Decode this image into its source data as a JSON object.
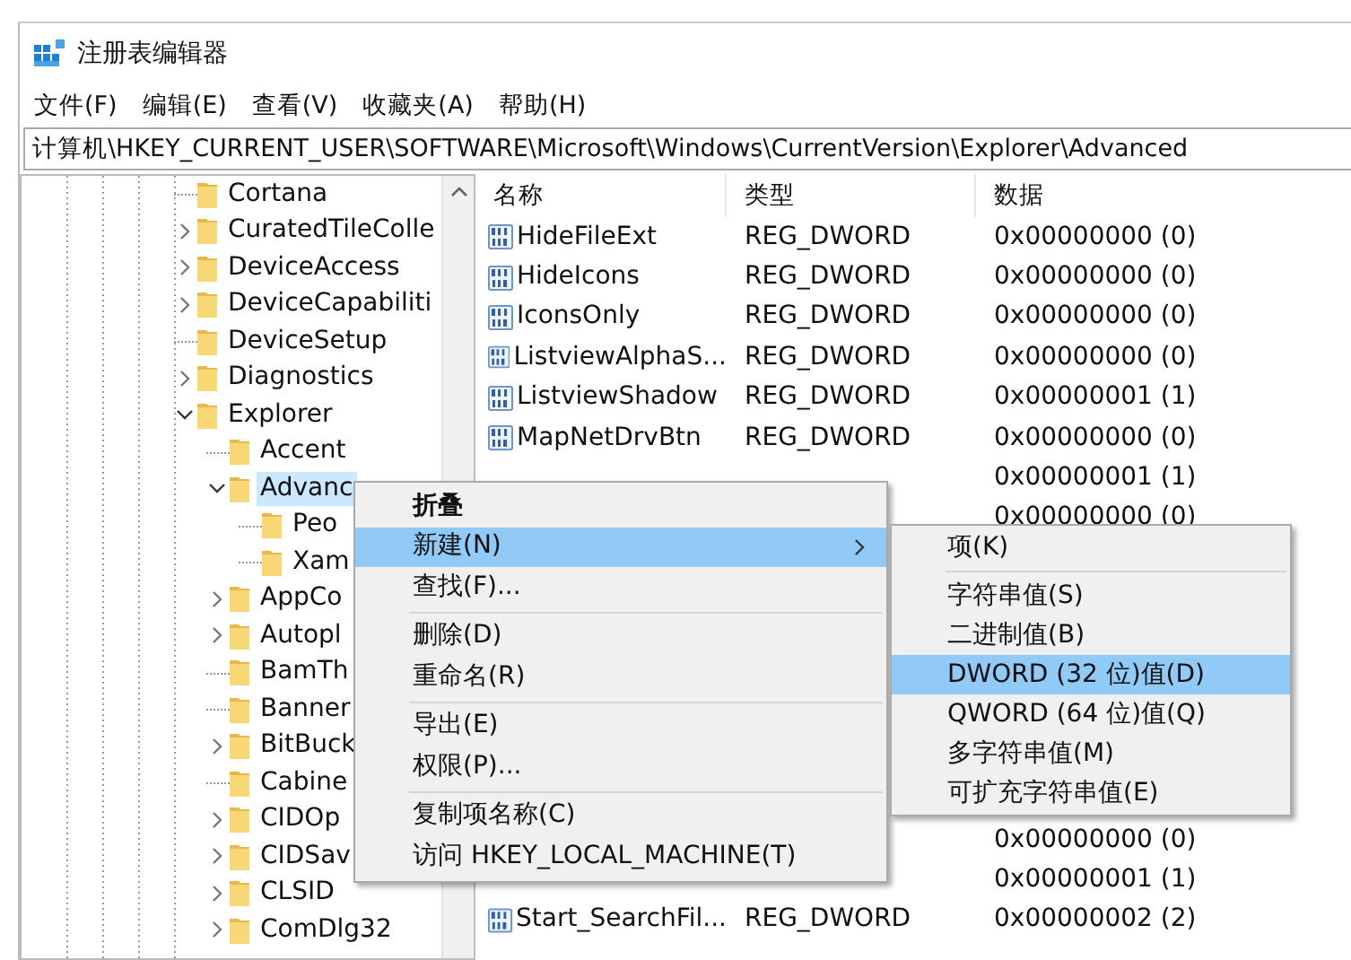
{
  "window": {
    "title": "注册表编辑器"
  },
  "menu_bar": [
    "文件(F)",
    "编辑(E)",
    "查看(V)",
    "收藏夹(A)",
    "帮助(H)"
  ],
  "address": "计算机\\HKEY_CURRENT_USER\\SOFTWARE\\Microsoft\\Windows\\CurrentVersion\\Explorer\\Advanced",
  "tree": {
    "items": [
      {
        "label": "Cortana",
        "selected": false
      },
      {
        "label": "CuratedTileColle",
        "expanded": false,
        "selected": false
      },
      {
        "label": "DeviceAccess",
        "expanded": false,
        "selected": false
      },
      {
        "label": "DeviceCapabiliti",
        "expanded": false,
        "selected": false
      },
      {
        "label": "DeviceSetup",
        "selected": false
      },
      {
        "label": "Diagnostics",
        "expanded": false,
        "selected": false
      },
      {
        "label": "Explorer",
        "expanded": true,
        "selected": false,
        "children": [
          {
            "label": "Accent",
            "selected": false
          },
          {
            "label": "Advanc",
            "expanded": true,
            "selected": true,
            "children": [
              {
                "label": "Peo",
                "selected": false
              },
              {
                "label": "Xam",
                "selected": false
              }
            ]
          },
          {
            "label": "AppCo",
            "expanded": false,
            "selected": false
          },
          {
            "label": "Autopl",
            "expanded": false,
            "selected": false
          },
          {
            "label": "BamTh",
            "selected": false
          },
          {
            "label": "Banner",
            "selected": false
          },
          {
            "label": "BitBuck",
            "expanded": false,
            "selected": false
          },
          {
            "label": "Cabine",
            "selected": false
          },
          {
            "label": "CIDOp",
            "expanded": false,
            "selected": false
          },
          {
            "label": "CIDSav",
            "expanded": false,
            "selected": false
          },
          {
            "label": "CLSID",
            "expanded": false,
            "selected": false
          },
          {
            "label": "ComDlg32",
            "expanded": false,
            "selected": false
          }
        ]
      }
    ]
  },
  "table": {
    "columns": [
      "名称",
      "类型",
      "数据"
    ],
    "rows_top": [
      {
        "name": "HideFileExt",
        "type": "REG_DWORD",
        "data": "0x00000000 (0)"
      },
      {
        "name": "HideIcons",
        "type": "REG_DWORD",
        "data": "0x00000000 (0)"
      },
      {
        "name": "IconsOnly",
        "type": "REG_DWORD",
        "data": "0x00000000 (0)"
      },
      {
        "name": "ListviewAlphaS...",
        "type": "REG_DWORD",
        "data": "0x00000000 (0)"
      },
      {
        "name": "ListviewShadow",
        "type": "REG_DWORD",
        "data": "0x00000001 (1)"
      },
      {
        "name": "MapNetDrvBtn",
        "type": "REG_DWORD",
        "data": "0x00000000 (0)"
      },
      {
        "data": "0x00000001 (1)"
      },
      {
        "data": "0x00000000 (0)"
      }
    ],
    "rows_bottom": [
      {
        "data": "0x00000000 (0)"
      },
      {
        "data": "0x00000001 (1)"
      },
      {
        "name": "Start_SearchFil...",
        "type": "REG_DWORD",
        "data": "0x00000002 (2)"
      }
    ]
  },
  "context_menu": {
    "items": [
      {
        "kind": "item",
        "label": "折叠",
        "default": true,
        "selected": false
      },
      {
        "kind": "submenu",
        "label": "新建(N)",
        "default": false,
        "selected": true
      },
      {
        "kind": "item",
        "label": "查找(F)...",
        "default": false,
        "selected": false
      },
      {
        "kind": "separator"
      },
      {
        "kind": "item",
        "label": "删除(D)",
        "default": false,
        "selected": false
      },
      {
        "kind": "item",
        "label": "重命名(R)",
        "default": false,
        "selected": false
      },
      {
        "kind": "separator"
      },
      {
        "kind": "item",
        "label": "导出(E)",
        "default": false,
        "selected": false
      },
      {
        "kind": "item",
        "label": "权限(P)...",
        "default": false,
        "selected": false
      },
      {
        "kind": "separator"
      },
      {
        "kind": "item",
        "label": "复制项名称(C)",
        "default": false,
        "selected": false
      },
      {
        "kind": "item",
        "label": "访问 HKEY_LOCAL_MACHINE(T)",
        "default": false,
        "selected": false
      }
    ]
  },
  "submenu": {
    "items": [
      {
        "kind": "item",
        "label": "项(K)",
        "selected": false
      },
      {
        "kind": "separator"
      },
      {
        "kind": "item",
        "label": "字符串值(S)",
        "selected": false
      },
      {
        "kind": "item",
        "label": "二进制值(B)",
        "selected": false
      },
      {
        "kind": "item",
        "label": "DWORD (32 位)值(D)",
        "selected": true
      },
      {
        "kind": "item",
        "label": "QWORD (64 位)值(Q)",
        "selected": false
      },
      {
        "kind": "item",
        "label": "多字符串值(M)",
        "selected": false
      },
      {
        "kind": "item",
        "label": "可扩充字符串值(E)",
        "selected": false
      }
    ]
  }
}
